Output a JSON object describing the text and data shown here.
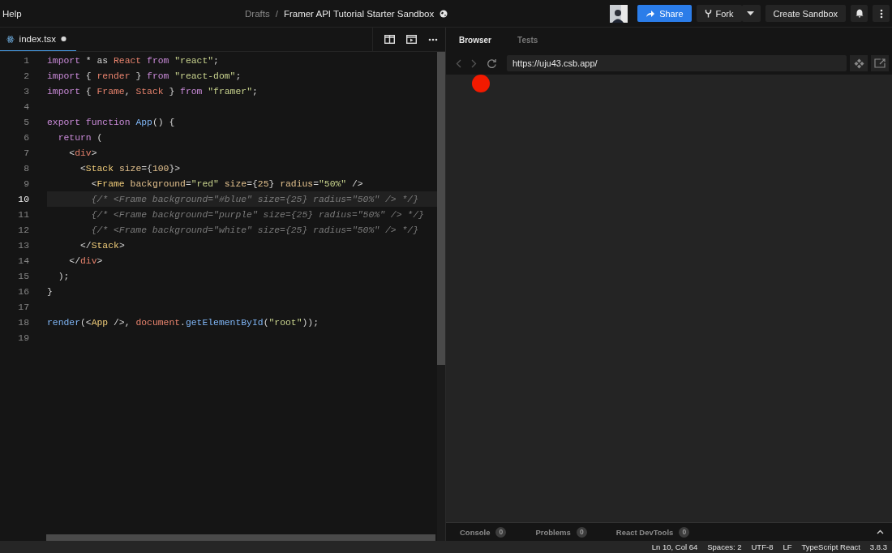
{
  "menu": {
    "label": "Help"
  },
  "breadcrumb": {
    "folder": "Drafts",
    "separator": "/",
    "title": "Framer API Tutorial Starter Sandbox"
  },
  "actions": {
    "share": "Share",
    "fork": "Fork",
    "create": "Create Sandbox"
  },
  "editor_tab": {
    "filename": "index.tsx",
    "modified": true
  },
  "code_lines": [
    {
      "number": "1",
      "current": false,
      "tokens": [
        {
          "kind": "keyword",
          "text": "import"
        },
        {
          "kind": "plain",
          "text": " * as "
        },
        {
          "kind": "ident",
          "text": "React"
        },
        {
          "kind": "keyword",
          "text": " from "
        },
        {
          "kind": "string",
          "text": "\"react\""
        },
        {
          "kind": "plain",
          "text": ";"
        }
      ]
    },
    {
      "number": "2",
      "current": false,
      "tokens": [
        {
          "kind": "keyword",
          "text": "import"
        },
        {
          "kind": "plain",
          "text": " { "
        },
        {
          "kind": "ident",
          "text": "render"
        },
        {
          "kind": "plain",
          "text": " } "
        },
        {
          "kind": "keyword",
          "text": "from "
        },
        {
          "kind": "string",
          "text": "\"react-dom\""
        },
        {
          "kind": "plain",
          "text": ";"
        }
      ]
    },
    {
      "number": "3",
      "current": false,
      "tokens": [
        {
          "kind": "keyword",
          "text": "import"
        },
        {
          "kind": "plain",
          "text": " { "
        },
        {
          "kind": "ident",
          "text": "Frame"
        },
        {
          "kind": "plain",
          "text": ", "
        },
        {
          "kind": "ident",
          "text": "Stack"
        },
        {
          "kind": "plain",
          "text": " } "
        },
        {
          "kind": "keyword",
          "text": "from "
        },
        {
          "kind": "string",
          "text": "\"framer\""
        },
        {
          "kind": "plain",
          "text": ";"
        }
      ]
    },
    {
      "number": "4",
      "current": false
    },
    {
      "number": "5",
      "current": false,
      "tokens": [
        {
          "kind": "keyword",
          "text": "export function "
        },
        {
          "kind": "func",
          "text": "App"
        },
        {
          "kind": "plain",
          "text": "() {"
        }
      ]
    },
    {
      "number": "6",
      "current": false,
      "tokens": [
        {
          "kind": "keyword",
          "text": "  return"
        },
        {
          "kind": "plain",
          "text": " ("
        }
      ]
    },
    {
      "number": "7",
      "current": false,
      "tokens": [
        {
          "kind": "plain",
          "text": "    <"
        },
        {
          "kind": "ident",
          "text": "div"
        },
        {
          "kind": "plain",
          "text": ">"
        }
      ]
    },
    {
      "number": "8",
      "current": false,
      "tokens": [
        {
          "kind": "plain",
          "text": "      <"
        },
        {
          "kind": "tag",
          "text": "Stack"
        },
        {
          "kind": "attr",
          "text": " size"
        },
        {
          "kind": "plain",
          "text": "={"
        },
        {
          "kind": "attr",
          "text": "100"
        },
        {
          "kind": "plain",
          "text": "}>"
        }
      ]
    },
    {
      "number": "9",
      "current": false,
      "tokens": [
        {
          "kind": "plain",
          "text": "        <"
        },
        {
          "kind": "tag",
          "text": "Frame"
        },
        {
          "kind": "attr",
          "text": " background"
        },
        {
          "kind": "plain",
          "text": "="
        },
        {
          "kind": "string",
          "text": "\"red\""
        },
        {
          "kind": "attr",
          "text": " size"
        },
        {
          "kind": "plain",
          "text": "={"
        },
        {
          "kind": "attr",
          "text": "25"
        },
        {
          "kind": "plain",
          "text": "} "
        },
        {
          "kind": "attr",
          "text": "radius"
        },
        {
          "kind": "plain",
          "text": "="
        },
        {
          "kind": "string",
          "text": "\"50%\""
        },
        {
          "kind": "plain",
          "text": " />"
        }
      ]
    },
    {
      "number": "10",
      "current": true,
      "tokens": [
        {
          "kind": "comment",
          "text": "        {/* <Frame background=\"#blue\" size={25} radius=\"50%\" /> */}"
        }
      ]
    },
    {
      "number": "11",
      "current": false,
      "tokens": [
        {
          "kind": "comment",
          "text": "        {/* <Frame background=\"purple\" size={25} radius=\"50%\" /> */}"
        }
      ]
    },
    {
      "number": "12",
      "current": false,
      "tokens": [
        {
          "kind": "comment",
          "text": "        {/* <Frame background=\"white\" size={25} radius=\"50%\" /> */}"
        }
      ]
    },
    {
      "number": "13",
      "current": false,
      "tokens": [
        {
          "kind": "plain",
          "text": "      </"
        },
        {
          "kind": "tag",
          "text": "Stack"
        },
        {
          "kind": "plain",
          "text": ">"
        }
      ]
    },
    {
      "number": "14",
      "current": false,
      "tokens": [
        {
          "kind": "plain",
          "text": "    </"
        },
        {
          "kind": "ident",
          "text": "div"
        },
        {
          "kind": "plain",
          "text": ">"
        }
      ]
    },
    {
      "number": "15",
      "current": false,
      "tokens": [
        {
          "kind": "plain",
          "text": "  );"
        }
      ]
    },
    {
      "number": "16",
      "current": false,
      "tokens": [
        {
          "kind": "plain",
          "text": "}"
        }
      ]
    },
    {
      "number": "17",
      "current": false
    },
    {
      "number": "18",
      "current": false,
      "tokens": [
        {
          "kind": "func",
          "text": "render"
        },
        {
          "kind": "plain",
          "text": "(<"
        },
        {
          "kind": "tag",
          "text": "App"
        },
        {
          "kind": "plain",
          "text": " />, "
        },
        {
          "kind": "ident",
          "text": "document"
        },
        {
          "kind": "plain",
          "text": "."
        },
        {
          "kind": "func",
          "text": "getElementById"
        },
        {
          "kind": "plain",
          "text": "("
        },
        {
          "kind": "string",
          "text": "\"root\""
        },
        {
          "kind": "plain",
          "text": "));"
        }
      ]
    },
    {
      "number": "19",
      "current": false
    }
  ],
  "preview_tabs": [
    {
      "label": "Browser",
      "selected": true
    },
    {
      "label": "Tests",
      "selected": false
    }
  ],
  "address_bar": {
    "value": "https://uju43.csb.app/"
  },
  "bottom_tabs": [
    {
      "label": "Console",
      "count": "0"
    },
    {
      "label": "Problems",
      "count": "0"
    },
    {
      "label": "React DevTools",
      "count": "0"
    }
  ],
  "status_bar": [
    "Ln 10, Col 64",
    "Spaces: 2",
    "UTF-8",
    "LF",
    "TypeScript React",
    "3.8.3"
  ]
}
